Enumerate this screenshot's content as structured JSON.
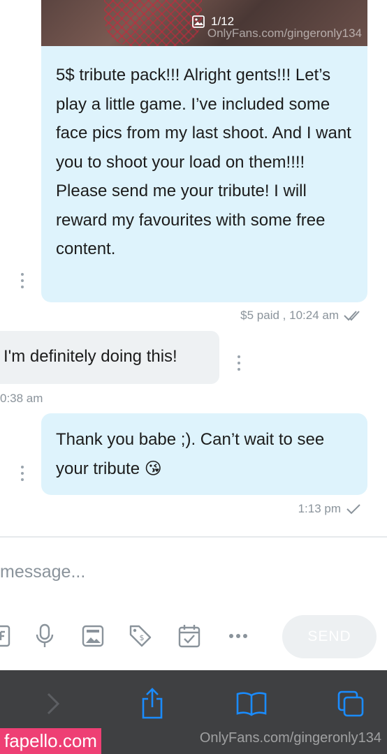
{
  "media": {
    "counter": "1/12",
    "watermark": "OnlyFans.com/gingeronly134"
  },
  "messages": [
    {
      "text": "5$ tribute pack!!! Alright gents!!! Let’s play a little game. I’ve included some face pics from my last shoot. And I want you to shoot your load on them!!!! Please send me your tribute! I will reward my favourites with some free content.",
      "meta": "$5 paid , 10:24 am"
    },
    {
      "text": "I'm definitely doing this!",
      "meta": "0:38 am"
    },
    {
      "text": "Thank you babe ;). Can’t wait to see your tribute",
      "emoji": "😘",
      "meta": "1:13 pm"
    }
  ],
  "composer": {
    "placeholder": "message...",
    "send_label": "SEND"
  },
  "browser": {
    "watermark_left": "fapello.com",
    "watermark_right": "OnlyFans.com/gingeronly134"
  },
  "colors": {
    "outgoing_bubble": "#def3fc",
    "incoming_bubble": "#eef1f3",
    "meta_text": "#8a939b",
    "browser_accent": "#1a8cff",
    "browser_bar": "#3f4042",
    "fapello_pink": "#ee3f74"
  }
}
